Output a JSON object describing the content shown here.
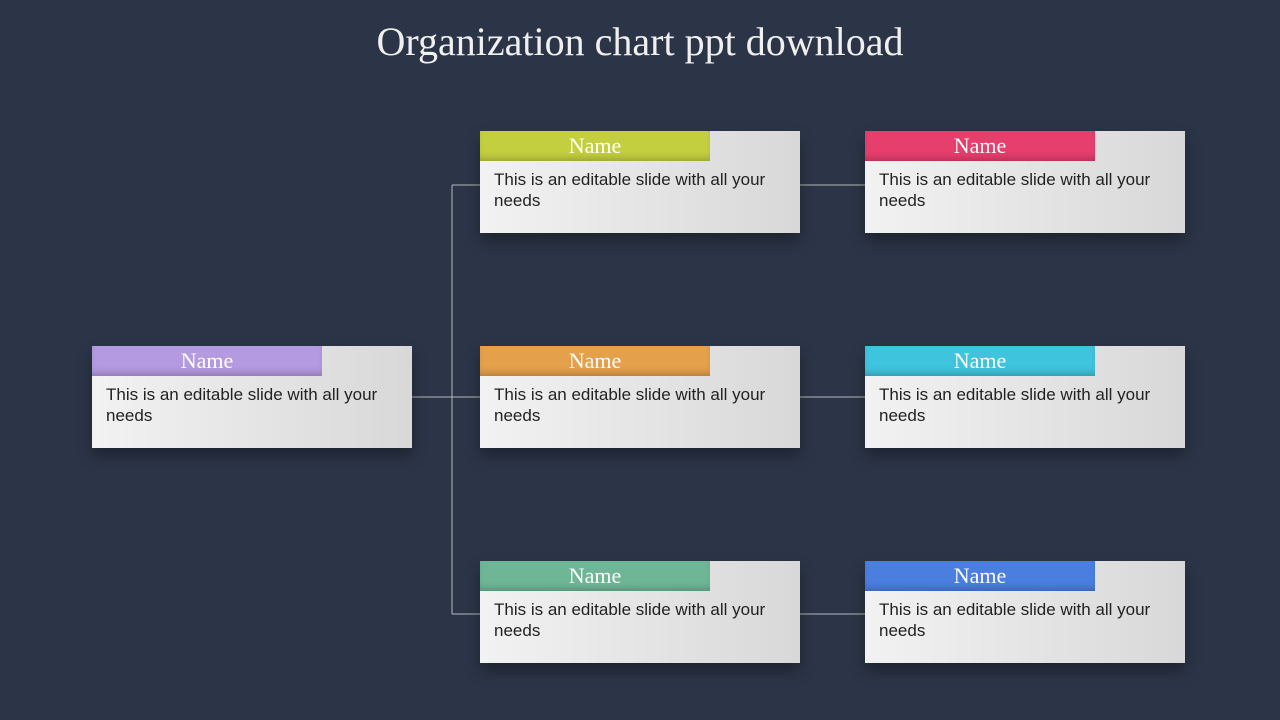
{
  "title": "Organization chart ppt download",
  "root": {
    "name": "Name",
    "desc": "This is an editable slide with all your needs",
    "color": "#b49ae0"
  },
  "mid": [
    {
      "name": "Name",
      "desc": "This is an editable slide with all your needs",
      "color": "#c4cf3f"
    },
    {
      "name": "Name",
      "desc": "This is an editable slide with all your needs",
      "color": "#e4a04b"
    },
    {
      "name": "Name",
      "desc": "This is an editable slide with all your needs",
      "color": "#6fb696"
    }
  ],
  "right": [
    {
      "name": "Name",
      "desc": "This is an editable slide with all your needs",
      "color": "#e63e6d"
    },
    {
      "name": "Name",
      "desc": "This is an editable slide with all your needs",
      "color": "#3fc4dd"
    },
    {
      "name": "Name",
      "desc": "This is an editable slide with all your needs",
      "color": "#4a7fe0"
    }
  ]
}
